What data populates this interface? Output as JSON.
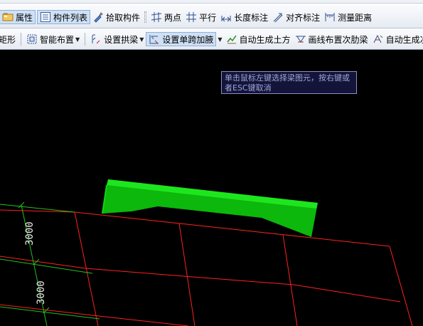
{
  "toolbar_top": {
    "note": ""
  },
  "toolbar1": {
    "items": [
      {
        "label": "属性",
        "icon": "properties-icon"
      },
      {
        "label": "构件列表",
        "icon": "component-list-icon"
      },
      {
        "label": "拾取构件",
        "icon": "pick-component-icon"
      },
      {
        "label": "两点",
        "icon": "two-point-icon"
      },
      {
        "label": "平行",
        "icon": "parallel-icon"
      },
      {
        "label": "长度标注",
        "icon": "length-dimension-icon"
      },
      {
        "label": "对齐标注",
        "icon": "aligned-dimension-icon"
      },
      {
        "label": "测量距离",
        "icon": "measure-distance-icon"
      }
    ]
  },
  "toolbar2": {
    "items": [
      {
        "label": "矩形",
        "icon": "rectangle-icon"
      },
      {
        "label": "智能布置",
        "icon": "smart-layout-icon"
      },
      {
        "label": "设置拱梁",
        "icon": "arch-beam-icon"
      },
      {
        "label": "设置单跨加腋",
        "icon": "single-span-haunch-icon"
      },
      {
        "label": "自动生成土方",
        "icon": "auto-earthwork-icon"
      },
      {
        "label": "画线布置次肋梁",
        "icon": "secondary-rib-icon"
      },
      {
        "label": "自动生成次",
        "icon": "auto-secondary-icon"
      }
    ]
  },
  "canvas": {
    "dimension_labels": [
      "3000",
      "3000"
    ],
    "colors": {
      "background": "#000000",
      "grid_red": "#ff2020",
      "grid_green": "#20c020",
      "beam_green": "#14e614",
      "dimension_text": "#e8e8e8"
    }
  },
  "tooltip": {
    "text": "单击鼠标左键选择梁图元，按右键或者ESC键取消"
  }
}
